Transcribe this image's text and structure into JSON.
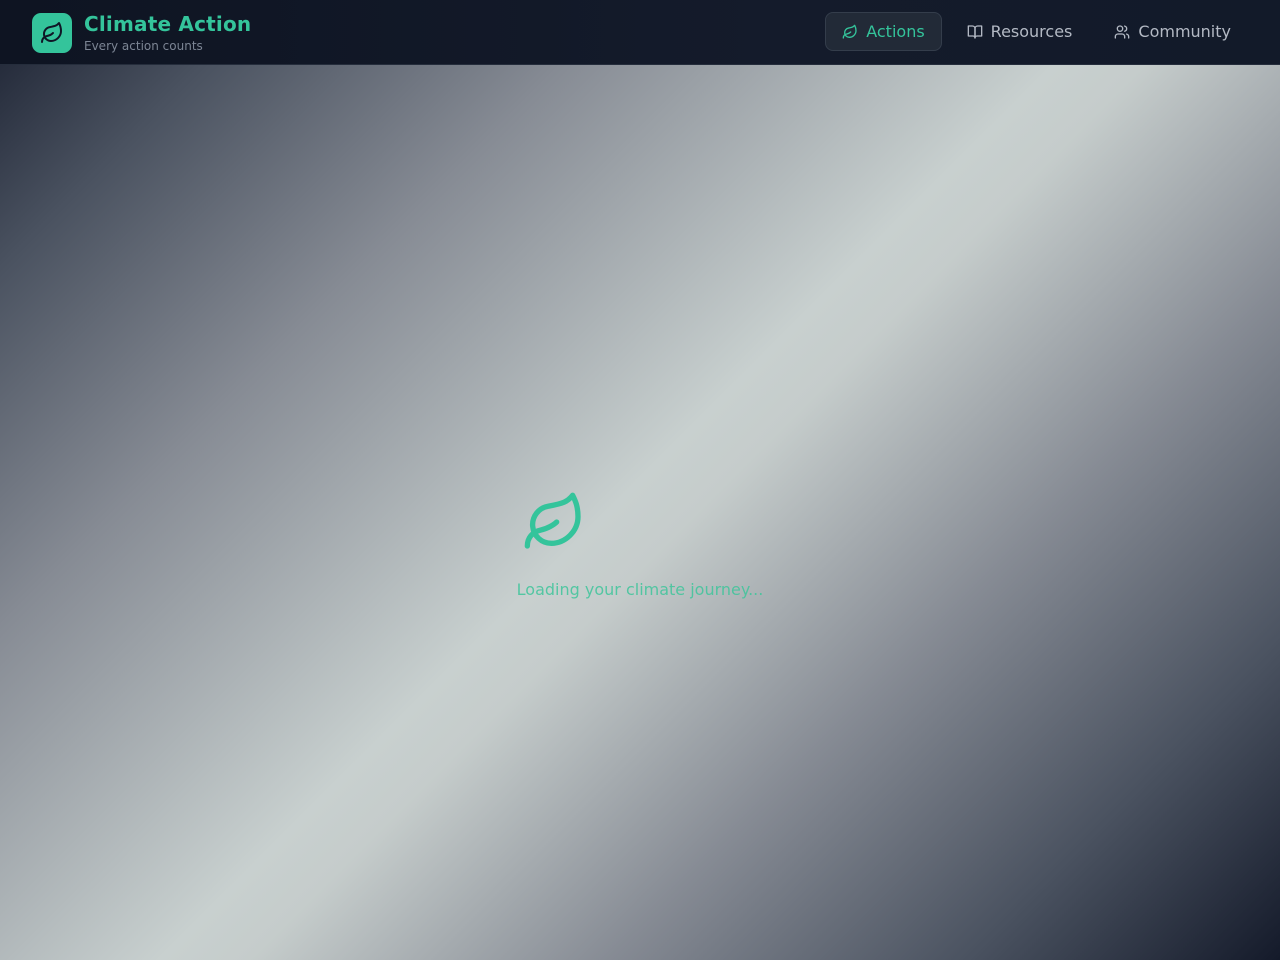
{
  "header": {
    "title": "Climate Action",
    "subtitle": "Every action counts",
    "logo_icon": "leaf-icon"
  },
  "nav": {
    "items": [
      {
        "label": "Actions",
        "icon": "leaf-icon",
        "active": true
      },
      {
        "label": "Resources",
        "icon": "book-open-icon",
        "active": false
      },
      {
        "label": "Community",
        "icon": "users-icon",
        "active": false
      }
    ]
  },
  "main": {
    "loading_icon": "leaf-icon",
    "loading_text": "Loading your climate journey..."
  },
  "colors": {
    "accent": "#34c49b",
    "topbar": "#0f1626",
    "nav_text": "#b3b9c4",
    "subtitle": "#7c8594"
  }
}
